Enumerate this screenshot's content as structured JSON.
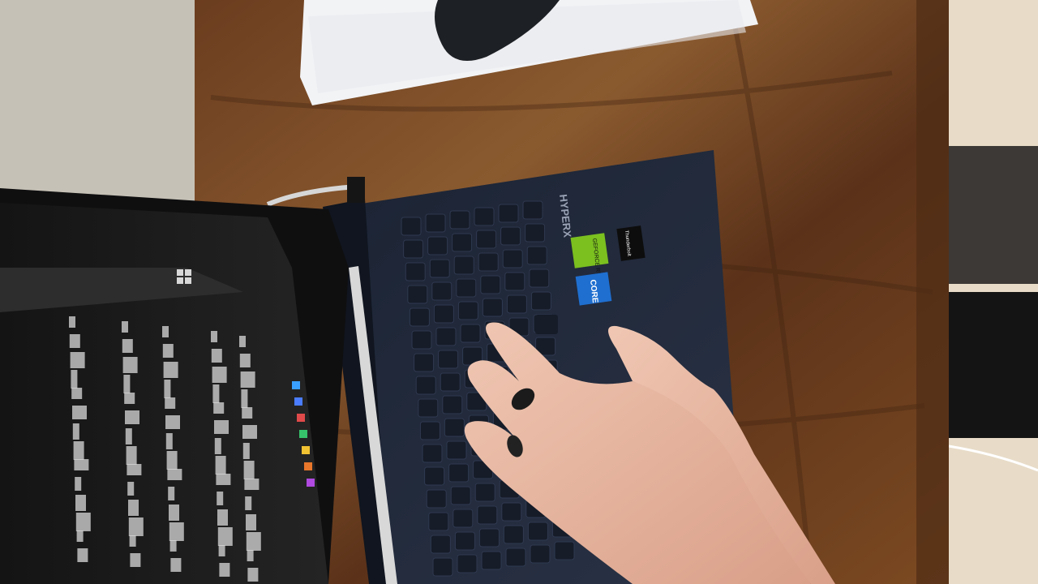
{
  "scene": {
    "title": "",
    "laptop": {
      "brand_mark": "HYPERX",
      "sticker_nvidia": "GEFORCE RTX",
      "sticker_intel": "CORE",
      "sticker_thunderbolt": "Thunderbolt"
    },
    "colors": {
      "desk": "#7a4a26",
      "desk_dark": "#4a2a14",
      "floor": "#e9dcc6",
      "wall": "#c6c1b6",
      "laptop_body": "#20283a",
      "screen": "#1a1a1a"
    }
  }
}
